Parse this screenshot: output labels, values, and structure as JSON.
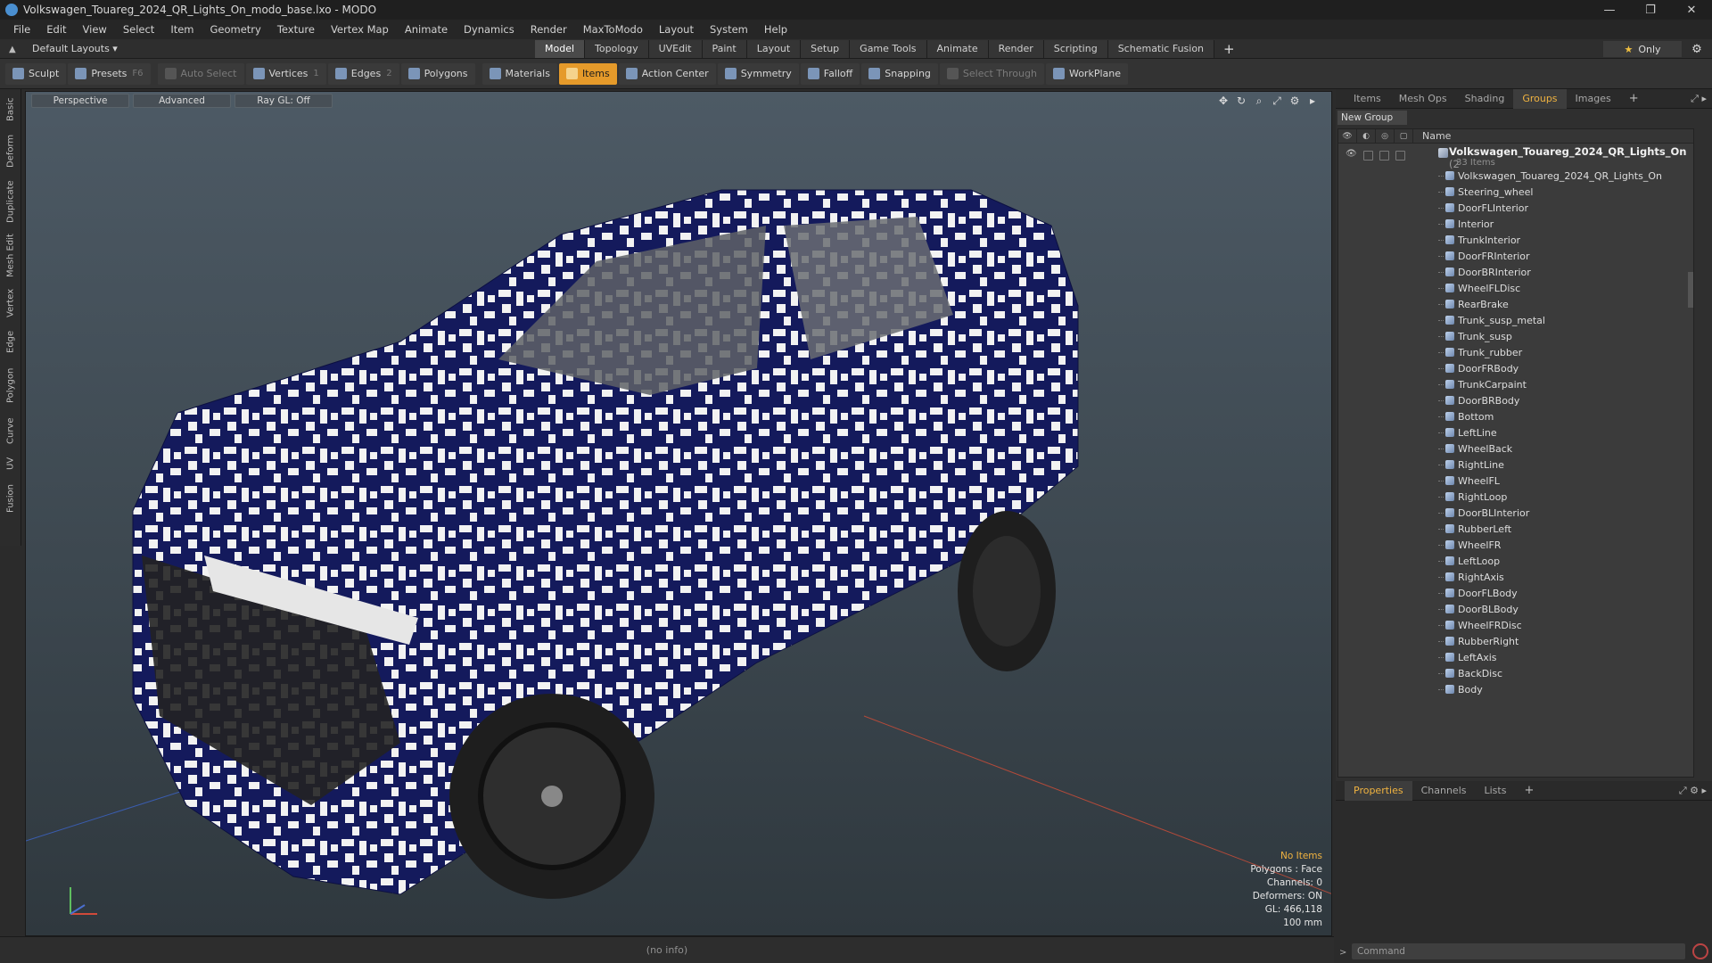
{
  "window": {
    "title": "Volkswagen_Touareg_2024_QR_Lights_On_modo_base.lxo - MODO",
    "minimize": "—",
    "restore": "❐",
    "close": "✕"
  },
  "menu": [
    "File",
    "Edit",
    "View",
    "Select",
    "Item",
    "Geometry",
    "Texture",
    "Vertex Map",
    "Animate",
    "Dynamics",
    "Render",
    "MaxToModo",
    "Layout",
    "System",
    "Help"
  ],
  "layoutbar": {
    "layout_select": "Default Layouts ▾",
    "tabs": [
      "Model",
      "Topology",
      "UVEdit",
      "Paint",
      "Layout",
      "Setup",
      "Game Tools",
      "Animate",
      "Render",
      "Scripting",
      "Schematic Fusion"
    ],
    "active_tab": "Model",
    "add": "+",
    "only_star": "★",
    "only_label": "Only",
    "gear": "⚙"
  },
  "toolbar": {
    "sculpt": "Sculpt",
    "presets": "Presets",
    "presets_key": "F6",
    "auto_select": "Auto Select",
    "vertices": "Vertices",
    "vertices_key": "1",
    "edges": "Edges",
    "edges_key": "2",
    "polygons": "Polygons",
    "materials": "Materials",
    "items": "Items",
    "action_center": "Action Center",
    "symmetry": "Symmetry",
    "falloff": "Falloff",
    "snapping": "Snapping",
    "select_through": "Select Through",
    "workplane": "WorkPlane"
  },
  "left_tabs": [
    "Basic",
    "Deform",
    "Duplicate",
    "Mesh Edit",
    "Vertex",
    "Edge",
    "Polygon",
    "Curve",
    "UV",
    "Fusion"
  ],
  "viewport": {
    "tabs": [
      "Perspective",
      "Advanced",
      "Ray GL: Off"
    ],
    "icons": [
      "move-icon",
      "rotate-icon",
      "zoom-icon",
      "fit-icon",
      "settings-icon",
      "expand-icon"
    ],
    "info": {
      "no_items": "No Items",
      "polygons": "Polygons : Face",
      "channels": "Channels: 0",
      "deformers": "Deformers: ON",
      "gl": "GL: 466,118",
      "scale": "100 mm"
    },
    "colors": {
      "car_blue": "#141a5c",
      "car_white": "#f2f2f2",
      "wheel": "#262626"
    }
  },
  "statusbar": {
    "text": "(no info)"
  },
  "right_panel": {
    "tabs": [
      "Items",
      "Mesh Ops",
      "Shading",
      "Groups",
      "Images"
    ],
    "active_tab": "Groups",
    "add": "+",
    "new_group": "New Group",
    "name_header": "Name",
    "root": {
      "label": "Volkswagen_Touareg_2024_QR_Lights_On",
      "suffix": "(2",
      "sub": "33 Items"
    },
    "children": [
      "Volkswagen_Touareg_2024_QR_Lights_On",
      "Steering_wheel",
      "DoorFLInterior",
      "Interior",
      "TrunkInterior",
      "DoorFRInterior",
      "DoorBRInterior",
      "WheelFLDisc",
      "RearBrake",
      "Trunk_susp_metal",
      "Trunk_susp",
      "Trunk_rubber",
      "DoorFRBody",
      "TrunkCarpaint",
      "DoorBRBody",
      "Bottom",
      "LeftLine",
      "WheelBack",
      "RightLine",
      "WheelFL",
      "RightLoop",
      "DoorBLInterior",
      "RubberLeft",
      "WheelFR",
      "LeftLoop",
      "RightAxis",
      "DoorFLBody",
      "DoorBLBody",
      "WheelFRDisc",
      "RubberRight",
      "LeftAxis",
      "BackDisc",
      "Body"
    ]
  },
  "props_panel": {
    "tabs": [
      "Properties",
      "Channels",
      "Lists"
    ],
    "active_tab": "Properties",
    "add": "+",
    "command_placeholder": "Command"
  }
}
